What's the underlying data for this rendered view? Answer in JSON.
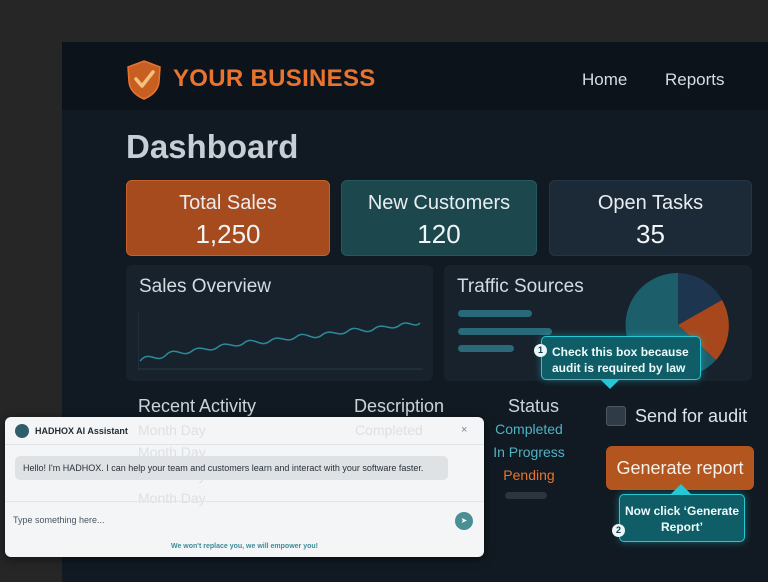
{
  "brand": {
    "name": "YOUR BUSINESS"
  },
  "nav": {
    "items": [
      "Home",
      "Reports"
    ]
  },
  "page": {
    "title": "Dashboard"
  },
  "kpis": [
    {
      "label": "Total Sales",
      "value": "1,250"
    },
    {
      "label": "New Customers",
      "value": "120"
    },
    {
      "label": "Open Tasks",
      "value": "35"
    }
  ],
  "panels": {
    "sales_title": "Sales Overview",
    "traffic_title": "Traffic Sources"
  },
  "activity": {
    "title": "Recent Activity",
    "headers": [
      "Description",
      "Status"
    ],
    "rows": [
      {
        "date": "Month Day",
        "description": "Completed",
        "status": "Completed"
      },
      {
        "date": "Month Day",
        "description": "",
        "status": "In Progress"
      },
      {
        "date": "Month Day",
        "description": "",
        "status": "Pending"
      },
      {
        "date": "Month Day",
        "description": "",
        "status": ""
      }
    ]
  },
  "audit": {
    "label": "Send for audit",
    "checked": false
  },
  "actions": {
    "generate_label": "Generate report"
  },
  "tooltips": [
    {
      "step": "1",
      "text": "Check this box because audit is required by law"
    },
    {
      "step": "2",
      "text": "Now click ‘Generate Report’"
    }
  ],
  "chat": {
    "title": "HADHOX AI Assistant",
    "close": "×",
    "message": "Hello! I'm HADHOX. I can help your team and customers learn and interact with your software faster.",
    "placeholder": "Type something here...",
    "send_icon": "➤",
    "footer": "We won't replace you, we will empower you!"
  },
  "colors": {
    "accent": "#e8742f",
    "brand_bg": "#111a22",
    "completed": "#4fb3c2",
    "in_progress": "#4fb3c2",
    "pending": "#e8742f",
    "tooltip": "#0f5d66"
  }
}
